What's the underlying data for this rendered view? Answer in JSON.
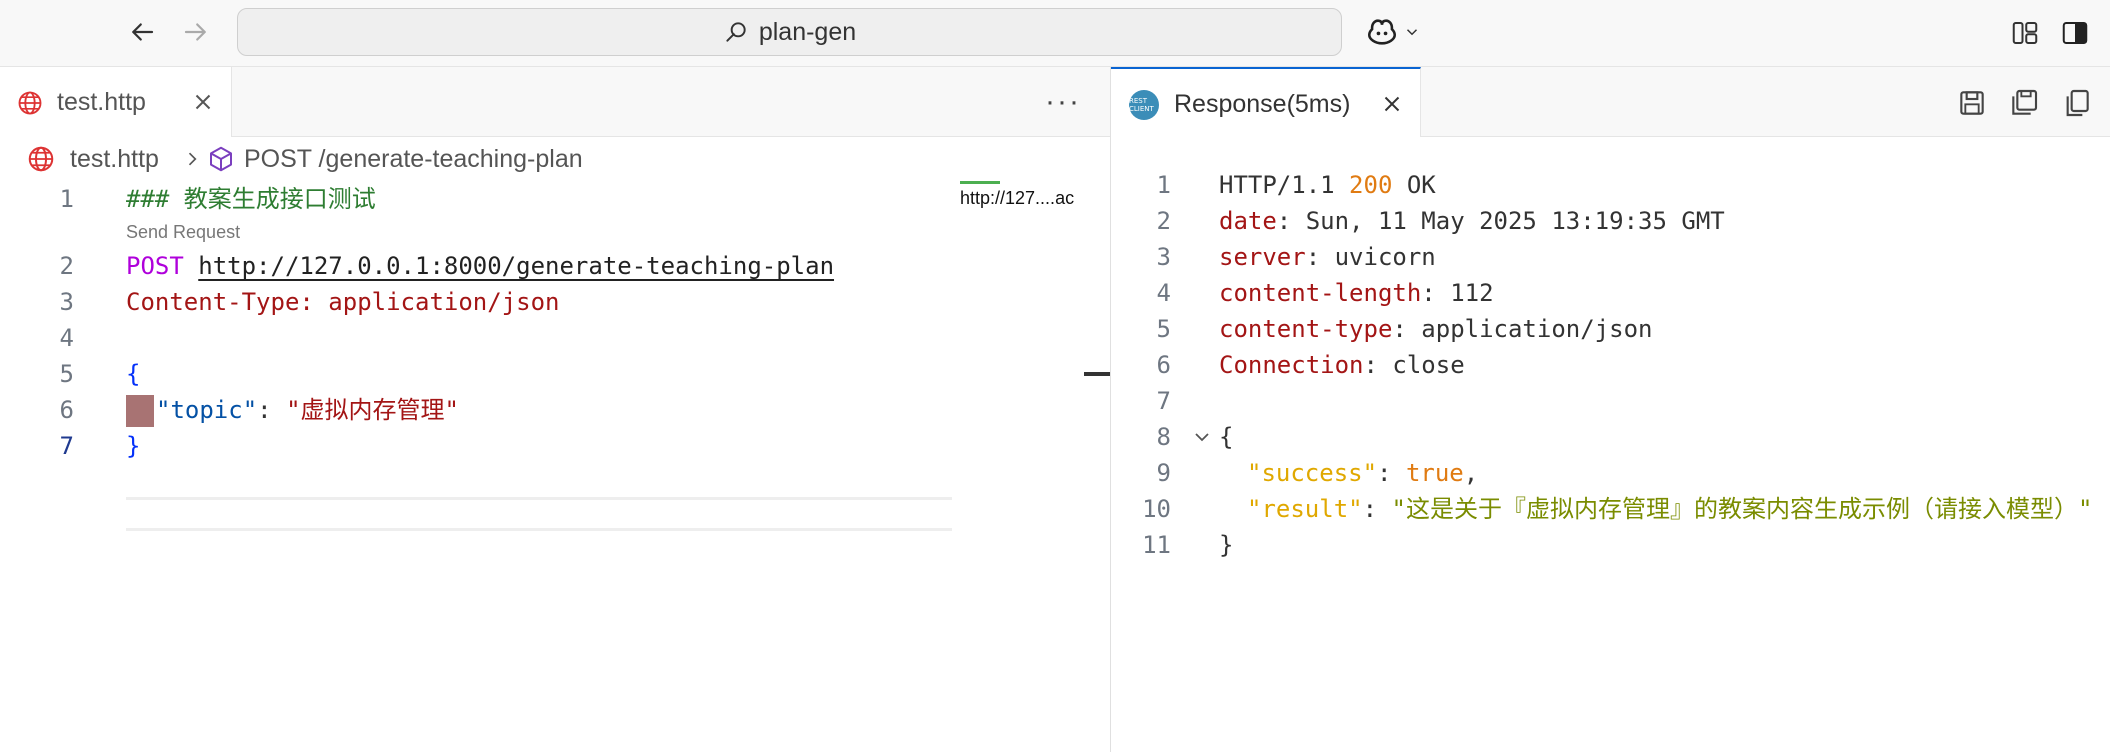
{
  "titlebar": {
    "search_text": "plan-gen"
  },
  "editor": {
    "tab": {
      "label": "test.http"
    },
    "breadcrumb": {
      "file": "test.http",
      "request": "POST /generate-teaching-plan"
    },
    "codelens": "Send Request",
    "minimap_hint": "http://127....ac",
    "lines": [
      {
        "num": "1",
        "comment": "### 教案生成接口测试"
      },
      {
        "num": "2",
        "method": "POST",
        "url": "http://127.0.0.1:8000/generate-teaching-plan"
      },
      {
        "num": "3",
        "header_key": "Content-Type:",
        "header_val": "application/json"
      },
      {
        "num": "4"
      },
      {
        "num": "5",
        "brace": "{"
      },
      {
        "num": "6",
        "key": "\"topic\"",
        "colon": ": ",
        "value": "\"虚拟内存管理\""
      },
      {
        "num": "7",
        "brace": "}"
      }
    ]
  },
  "response": {
    "tab": {
      "label": "Response(5ms)",
      "icon_text": "REST CLIENT"
    },
    "lines": [
      {
        "num": "1",
        "proto": "HTTP/1.1 ",
        "code": "200",
        "reason": " OK"
      },
      {
        "num": "2",
        "key": "date",
        "value": ": Sun, 11 May 2025 13:19:35 GMT"
      },
      {
        "num": "3",
        "key": "server",
        "value": ": uvicorn"
      },
      {
        "num": "4",
        "key": "content-length",
        "value": ": 112"
      },
      {
        "num": "5",
        "key": "content-type",
        "value": ": application/json"
      },
      {
        "num": "6",
        "key": "Connection",
        "value": ": close"
      },
      {
        "num": "7"
      },
      {
        "num": "8",
        "brace": "{"
      },
      {
        "num": "9",
        "jkey": "\"success\"",
        "sep": ": ",
        "jval": "true",
        "tail": ","
      },
      {
        "num": "10",
        "jkey": "\"result\"",
        "sep": ": ",
        "jval": "\"这是关于『虚拟内存管理』的教案内容生成示例（请接入模型）\""
      },
      {
        "num": "11",
        "brace": "}"
      }
    ]
  },
  "colors": {
    "accent": "#0a64d2",
    "comment": "#2e7d32",
    "method": "#af00db",
    "header_key": "#a31515",
    "json_key": "#0451a5",
    "status_code": "#e07b12"
  }
}
